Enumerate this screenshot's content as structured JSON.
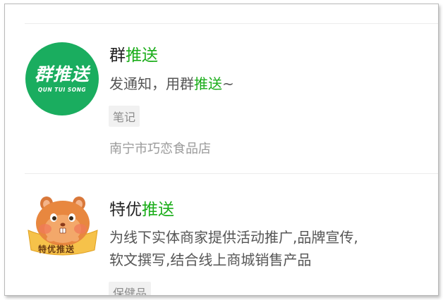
{
  "results": [
    {
      "logo_text": "群推送",
      "logo_subtext": "QUN TUI SONG",
      "title_prefix": "群",
      "title_highlight": "推送",
      "desc_line1_prefix": "发通知，用群",
      "desc_line1_highlight": "推送",
      "desc_line1_suffix": "~",
      "tag": "笔记",
      "owner": "南宁市巧恋食品店"
    },
    {
      "logo_text": "特优推送",
      "title_prefix": "特优",
      "title_highlight": "推送",
      "desc_line1": "为线下实体商家提供活动推广,品牌宣传,",
      "desc_line2": "软文撰写,结合线上商城销售产品",
      "tag": "保健品"
    }
  ],
  "colors": {
    "highlight": "#1aad19",
    "logo_green": "#1aad5f",
    "divider": "#ececec"
  }
}
